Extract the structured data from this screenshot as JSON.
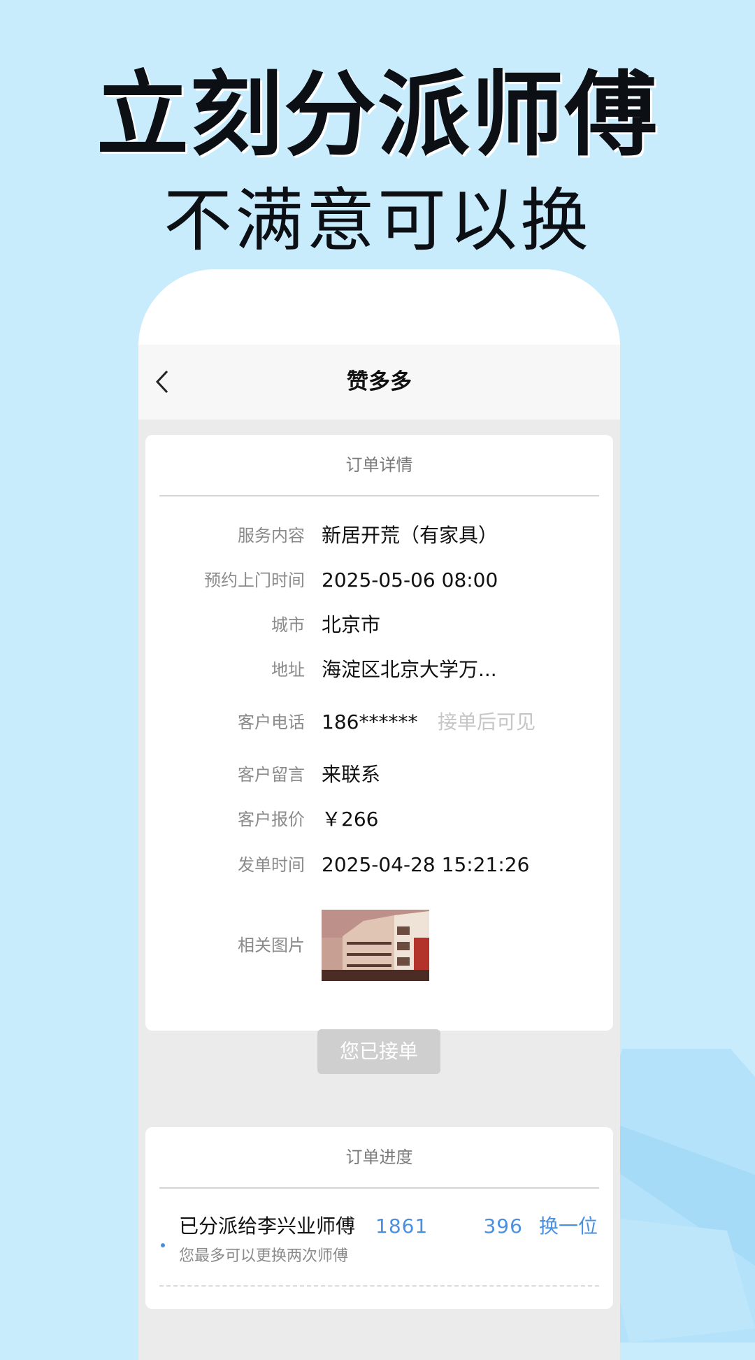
{
  "hero": {
    "title": "立刻分派师傅",
    "subtitle": "不满意可以换"
  },
  "nav": {
    "title": "赞多多",
    "back_icon": "chevron-left-icon"
  },
  "order_details": {
    "header": "订单详情",
    "rows": [
      {
        "label": "服务内容",
        "value": "新居开荒（有家具）"
      },
      {
        "label": "预约上门时间",
        "value": "2025-05-06 08:00"
      },
      {
        "label": "城市",
        "value": "北京市"
      },
      {
        "label": "地址",
        "value": "海淀区北京大学万..."
      },
      {
        "label": "客户电话",
        "value": "186******",
        "hint": "接单后可见"
      },
      {
        "label": "客户留言",
        "value": "来联系"
      },
      {
        "label": "客户报价",
        "value": "￥266"
      },
      {
        "label": "发单时间",
        "value": "2025-04-28 15:21:26"
      },
      {
        "label": "相关图片"
      }
    ],
    "accept_button": "您已接单"
  },
  "order_progress": {
    "header": "订单进度",
    "assigned_text": "已分派给李兴业师傅",
    "phone": "1861        396",
    "switch_label": "换一位",
    "note": "您最多可以更换两次师傅"
  },
  "colors": {
    "background": "#c9ecfc",
    "accent": "#4a90e2",
    "disabled_button": "#cfcfcf"
  }
}
